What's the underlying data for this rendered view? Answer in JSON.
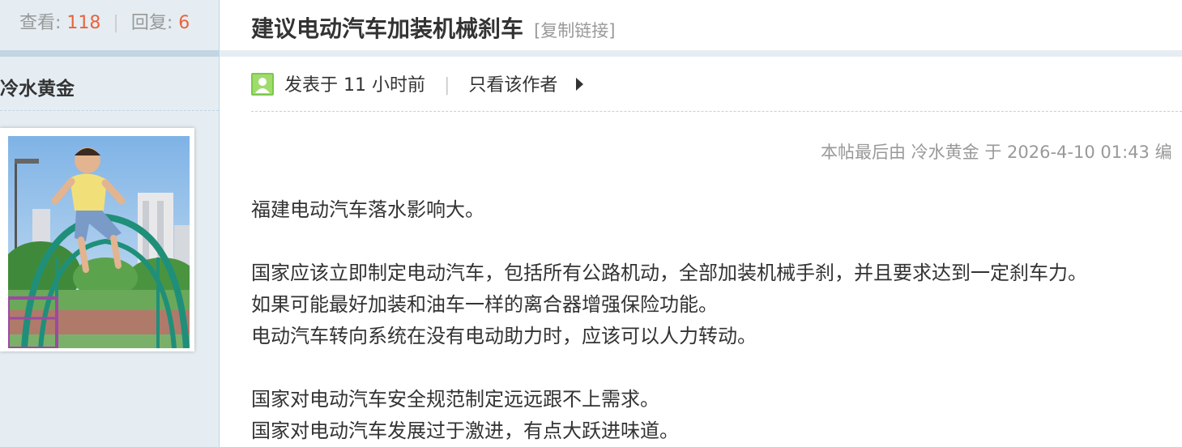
{
  "stats": {
    "views_label": "查看:",
    "views_count": "118",
    "separator": "|",
    "replies_label": "回复:",
    "replies_count": "6"
  },
  "author": {
    "name": "冷水黄金",
    "avatar_icon": "child-on-playground-photo"
  },
  "post": {
    "title": "建议电动汽车加装机械刹车",
    "copy_link": "[复制链接]",
    "posted_time": "发表于 11 小时前",
    "meta_separator": "|",
    "author_only": "只看该作者",
    "edit_note": "本帖最后由 冷水黄金 于 2026-4-10 01:43 编",
    "body_lines": [
      "福建电动汽车落水影响大。",
      "",
      "国家应该立即制定电动汽车，包括所有公路机动，全部加装机械手刹，并且要求达到一定刹车力。",
      "如果可能最好加装和油车一样的离合器增强保险功能。",
      "电动汽车转向系统在没有电动助力时，应该可以人力转动。",
      "",
      "国家对电动汽车安全规范制定远远跟不上需求。",
      "国家对电动汽车发展过于激进，有点大跃进味道。"
    ]
  },
  "colors": {
    "accent_orange": "#e8643c",
    "sidebar_bg": "#e5edf2",
    "band": "#c2d5e3",
    "muted_text": "#999999"
  }
}
